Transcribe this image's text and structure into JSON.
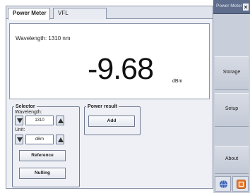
{
  "tabs": [
    {
      "label": "Power Meter",
      "active": true
    },
    {
      "label": "VFL",
      "active": false
    }
  ],
  "display": {
    "wavelength_label": "Wavelength: 1310 nm",
    "reading": "-9.68",
    "unit": "dBm"
  },
  "selector": {
    "legend": "Selector",
    "wavelength_label": "Wavelength:",
    "wavelength_value": "1310",
    "unit_label": "Unit:",
    "unit_value": "dBm",
    "reference_label": "Reference",
    "nulling_label": "Nulling"
  },
  "power_result": {
    "legend": "Power result",
    "add_label": "Add"
  },
  "side_panel": {
    "title": "Power Meter",
    "buttons": [
      "Storage",
      "Setup",
      "About"
    ]
  },
  "icons": {
    "bottom_left": "globe-icon",
    "bottom_right": "power-icon",
    "accent_orange": "#e8772a",
    "accent_blue": "#3a5fb0"
  }
}
